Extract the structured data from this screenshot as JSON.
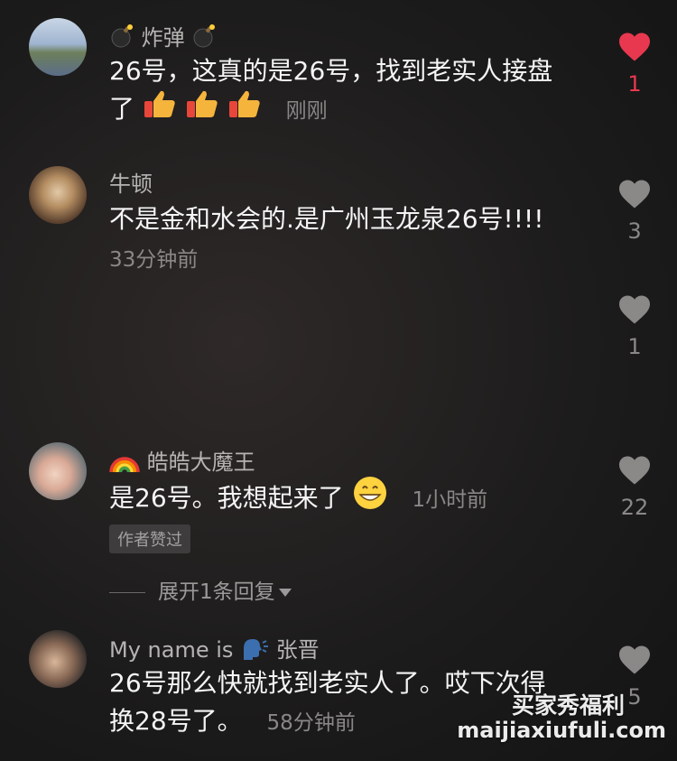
{
  "colors": {
    "liked": "#e8384f",
    "muted": "#8a8787",
    "name": "#b6b3b3",
    "text": "#f5f5f5"
  },
  "comments": [
    {
      "username": "炸弹",
      "username_emoji": "bomb-icon",
      "text_line1": "26号，这真的是26号，找到老实人接盘",
      "text_line2": "了",
      "emojis": [
        "thumbs-up-icon",
        "thumbs-up-icon",
        "thumbs-up-icon"
      ],
      "time": "刚刚",
      "likes": "1",
      "liked": true
    },
    {
      "username": "牛顿",
      "text_line1": "不是金和水会的.是广州玉龙泉26号!!!!",
      "time": "33分钟前",
      "likes": "3",
      "liked": false
    },
    {
      "likes": "1",
      "liked": false
    },
    {
      "username": "皓皓大魔王",
      "username_emoji": "rainbow-icon",
      "text_line1": "是26号。我想起来了",
      "emoji": "grinning-face-icon",
      "time": "1小时前",
      "badge": "作者赞过",
      "likes": "22",
      "liked": false
    },
    {
      "username_prefix": "My name is",
      "username_emoji": "speaking-head-icon",
      "username": "张晋",
      "text_line1": "26号那么快就找到老实人了。哎下次得",
      "text_line2": "换28号了。",
      "time": "58分钟前",
      "likes": "5",
      "liked": false
    }
  ],
  "expand_replies": "展开1条回复",
  "watermark": {
    "line1": "买家秀福利",
    "line2": "maijiaxiufuli.com"
  }
}
